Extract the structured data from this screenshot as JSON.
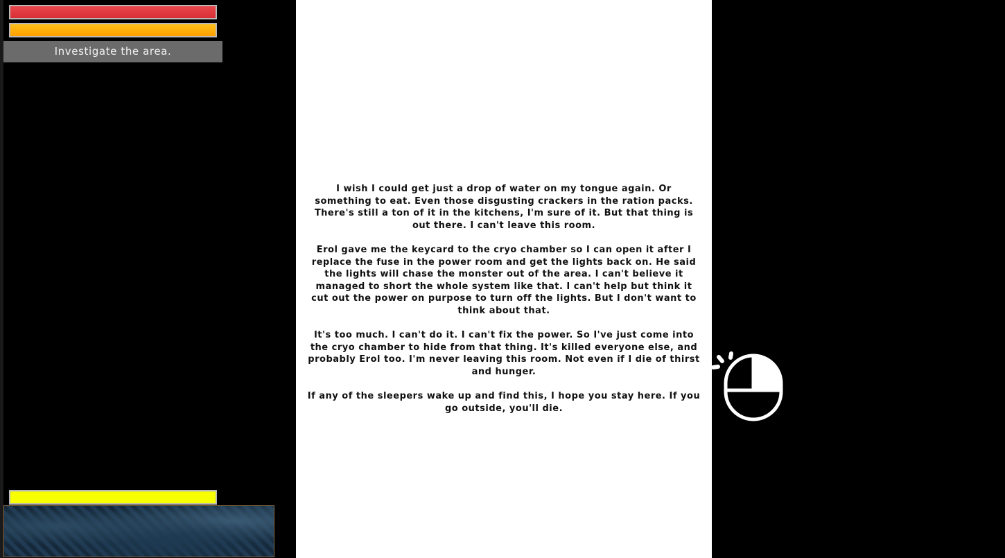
{
  "hud": {
    "health": 1.0,
    "stamina": 1.0,
    "light": 1.0,
    "objective": "Investigate the area."
  },
  "note": {
    "paragraphs": [
      "I wish I could get just a drop of water on my tongue again. Or something to eat. Even those disgusting crackers in the ration packs. There's still a ton of it in the kitchens, I'm sure of it. But that thing is out there. I can't leave this room.",
      "Erol gave me the keycard to the cryo chamber so I can open it after I replace the fuse in the power room and get the lights back on. He said the lights will chase the monster out of the area. I can't believe it managed to short the whole system like that. I can't help but think it cut out the power on purpose to turn off the lights. But I don't want to think about that.",
      "It's too much. I can't do it. I can't fix the power. So I've just come into the cryo chamber to hide from that thing. It's killed everyone else, and probably Erol too. I'm never leaving this room. Not even if I die of thirst and hunger.",
      "If any of the sleepers wake up and find this, I hope you stay here. If you go outside, you'll die."
    ]
  },
  "prompt": {
    "icon": "mouse-left-click-icon"
  },
  "colors": {
    "health": "#d92f36",
    "stamina": "#ff9f00",
    "light": "#f7ff00",
    "objective_bg": "#6b6b6b",
    "page": "#ffffff"
  }
}
